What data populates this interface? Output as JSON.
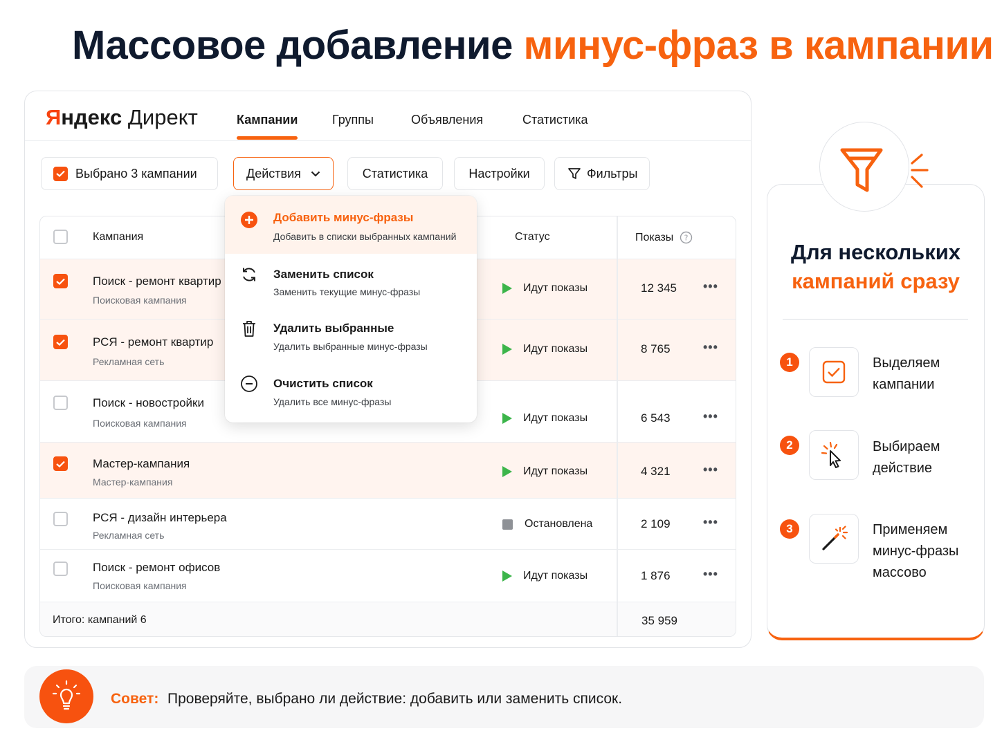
{
  "headline": {
    "part1": "Массовое добавление",
    "part2": "минус-фраз в кампании"
  },
  "app": {
    "logo": {
      "brand": "Яндекс",
      "product": "Директ"
    },
    "nav_tabs": [
      "Кампании",
      "Группы",
      "Объявления",
      "Статистика"
    ],
    "active_tab": "Кампании",
    "toolbar": {
      "selected_label": "Выбрано 3 кампании",
      "actions_label": "Действия",
      "statistics_label": "Статистика",
      "settings_label": "Настройки",
      "filters_label": "Фильтры"
    },
    "table": {
      "columns": {
        "campaign": "Кампания",
        "status": "Статус",
        "shows": "Показы"
      },
      "rows": [
        {
          "name": "Поиск - ремонт квартир",
          "type": "Поисковая кампания",
          "checked": true,
          "status": "Идут показы",
          "status_kind": "running",
          "shows": "12 345"
        },
        {
          "name": "РСЯ - ремонт квартир",
          "type": "Рекламная сеть",
          "checked": true,
          "status": "Идут показы",
          "status_kind": "running",
          "shows": "8 765"
        },
        {
          "name": "Поиск - новостройки",
          "type": "Поисковая кампания",
          "checked": false,
          "status": "Идут показы",
          "status_kind": "running",
          "shows": "6 543"
        },
        {
          "name": "Мастер-кампания",
          "type": "Мастер-кампания",
          "checked": true,
          "status": "Идут показы",
          "status_kind": "running",
          "shows": "4 321"
        },
        {
          "name": "РСЯ - дизайн интерьера",
          "type": "Рекламная сеть",
          "checked": false,
          "status": "Остановлена",
          "status_kind": "stopped",
          "shows": "2 109"
        },
        {
          "name": "Поиск - ремонт офисов",
          "type": "Поисковая кампания",
          "checked": false,
          "status": "Идут показы",
          "status_kind": "running",
          "shows": "1 876"
        }
      ],
      "total_label": "Итого: кампаний 6",
      "total_shows": "35 959"
    },
    "dropdown": [
      {
        "title": "Добавить минус-фразы",
        "subtitle": "Добавить в списки выбранных кампаний",
        "icon": "plus-circle-icon",
        "highlighted": true
      },
      {
        "title": "Заменить список",
        "subtitle": "Заменить текущие минус-фразы",
        "icon": "refresh-icon",
        "highlighted": false
      },
      {
        "title": "Удалить выбранные",
        "subtitle": "Удалить выбранные минус-фразы",
        "icon": "trash-icon",
        "highlighted": false
      },
      {
        "title": "Очистить список",
        "subtitle": "Удалить все минус-фразы",
        "icon": "minus-circle-icon",
        "highlighted": false
      }
    ]
  },
  "side": {
    "title_line1": "Для нескольких",
    "title_line2": "кампаний сразу",
    "steps": [
      {
        "num": "1",
        "line1": "Выделяем",
        "line2": "кампании",
        "line3": "",
        "icon": "checkbox-icon"
      },
      {
        "num": "2",
        "line1": "Выбираем",
        "line2": "действие",
        "line3": "",
        "icon": "cursor-click-icon"
      },
      {
        "num": "3",
        "line1": "Применяем",
        "line2": "минус-фразы",
        "line3": "массово",
        "icon": "magic-wand-icon"
      }
    ]
  },
  "tip": {
    "label": "Совет:",
    "text": "Проверяйте, выбрано ли действие: добавить или заменить список."
  },
  "colors": {
    "accent": "#f7620f",
    "navy": "#0f1a2e",
    "green": "#3cb54a",
    "selected_row": "#fff4ef"
  }
}
